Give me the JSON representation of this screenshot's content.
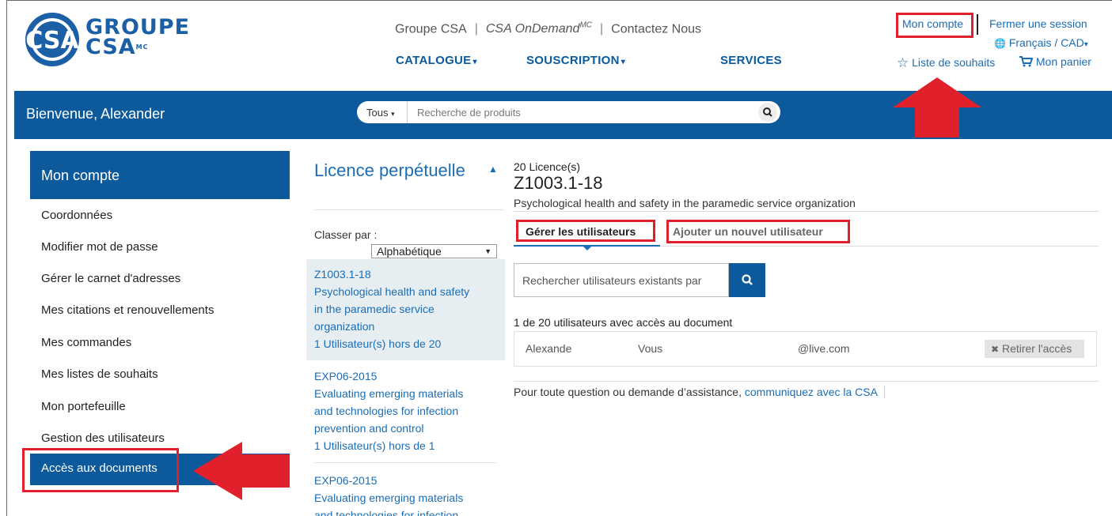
{
  "brand": {
    "logo_line1": "GROUPE",
    "logo_line2": "CSA",
    "logo_mark": "CSA",
    "logo_small": "MC",
    "primary_color": "#0c5a9c",
    "link_color": "#1b6db5",
    "highlight_color": "#e0202a"
  },
  "header": {
    "top_links": [
      "Groupe CSA",
      "CSA OnDemand",
      "Contactez Nous"
    ],
    "ondemand_sup": "MC",
    "nav": [
      "CATALOGUE",
      "SOUSCRIPTION",
      "SERVICES"
    ],
    "account": "Mon compte",
    "logout": "Fermer une session",
    "language": "Français / CAD",
    "wishlist": "Liste de souhaits",
    "cart": "Mon panier"
  },
  "bar": {
    "welcome": "Bienvenue, Alexander",
    "search_category": "Tous",
    "search_placeholder": "Recherche de produits"
  },
  "sidebar": {
    "title": "Mon compte",
    "items": [
      "Coordonnées",
      "Modifier mot de passe",
      "Gérer le carnet d'adresses",
      "Mes citations et renouvellements",
      "Mes commandes",
      "Mes listes de souhaits",
      "Mon portefeuille",
      "Gestion des utilisateurs"
    ],
    "active_item": "Accès aux documents"
  },
  "licenses": {
    "title": "Licence perpétuelle",
    "sort_label": "Classer par :",
    "sort_value": "Alphabétique",
    "items": [
      {
        "code": "Z1003.1-18",
        "title_1": "Psychological health and safety",
        "title_2": "in the paramedic service",
        "title_3": "organization",
        "users": "1 Utilisateur(s) hors de 20"
      },
      {
        "code": "EXP06-2015",
        "title_1": "Evaluating emerging materials",
        "title_2": "and technologies for infection",
        "title_3": "prevention and control",
        "users": "1 Utilisateur(s) hors de 1"
      },
      {
        "code": "EXP06-2015",
        "title_1": "Evaluating emerging materials",
        "title_2": "and technologies for infection"
      }
    ]
  },
  "detail": {
    "license_count": "20 Licence(s)",
    "code": "Z1003.1-18",
    "title": "Psychological health and safety in the paramedic service organization",
    "tabs": [
      "Gérer les utilisateurs",
      "Ajouter un nouvel utilisateur"
    ],
    "user_search_placeholder": "Rechercher utilisateurs existants par",
    "access_summary": "1 de 20 utilisateurs avec accès au document",
    "users": [
      {
        "name": "Alexande",
        "role": "Vous",
        "email": "@live.com",
        "action": "Retirer l'accès"
      }
    ],
    "help_text": "Pour toute question ou demande d’assistance,",
    "help_link": "communiquez avec la CSA"
  }
}
